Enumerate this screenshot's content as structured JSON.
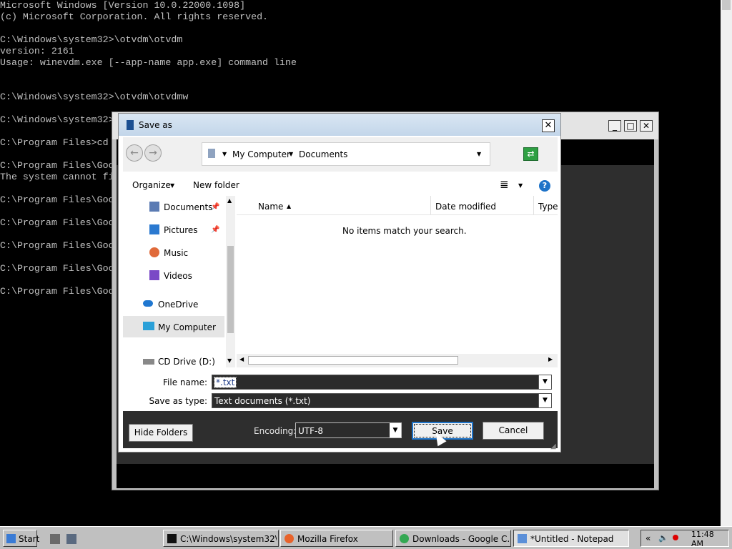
{
  "console": {
    "lines": [
      "Microsoft Windows [Version 10.0.22000.1098]",
      "(c) Microsoft Corporation. All rights reserved.",
      "",
      "C:\\Windows\\system32>\\otvdm\\otvdm",
      "version: 2161",
      "Usage: winevdm.exe [--app-name app.exe] command line",
      "",
      "",
      "C:\\Windows\\system32>\\otvdm\\otvdmw",
      "",
      "C:\\Windows\\system32>",
      "",
      "C:\\Program Files>cd",
      "",
      "C:\\Program Files\\Goo",
      "The system cannot fi",
      "",
      "C:\\Program Files\\Goo",
      "",
      "C:\\Program Files\\Goo",
      "",
      "C:\\Program Files\\Goo",
      "",
      "C:\\Program Files\\Goo",
      "",
      "C:\\Program Files\\Goo"
    ]
  },
  "notepad_window": {
    "minimize": "_",
    "maximize": "□",
    "close": "✕"
  },
  "dialog": {
    "title": "Save as",
    "close": "✕",
    "address": {
      "segments": [
        "My Computer",
        "Documents"
      ],
      "dropdown": "▼"
    },
    "toolbar": {
      "organize": "Organize",
      "new_folder": "New folder",
      "view_icon": "≣",
      "help": "?"
    },
    "tree": [
      {
        "label": "Documents",
        "icon": "documents-icon",
        "color": "#5b7bb3",
        "pinned": true
      },
      {
        "label": "Pictures",
        "icon": "pictures-icon",
        "color": "#2b79d0",
        "pinned": true
      },
      {
        "label": "Music",
        "icon": "music-icon",
        "color": "#e06a3a",
        "pinned": false
      },
      {
        "label": "Videos",
        "icon": "videos-icon",
        "color": "#7a48c6",
        "pinned": false
      },
      {
        "label": "OneDrive",
        "icon": "onedrive-icon",
        "color": "#1f77d0",
        "pinned": false
      },
      {
        "label": "My Computer",
        "icon": "computer-icon",
        "color": "#2aa0d8",
        "pinned": false
      },
      {
        "label": "CD Drive (D:)",
        "icon": "cd-drive-icon",
        "color": "#888888",
        "pinned": false
      }
    ],
    "list": {
      "columns": [
        "Name",
        "Date modified",
        "Type"
      ],
      "empty_message": "No items match your search."
    },
    "file_name_label": "File name:",
    "file_name_value": "*.txt",
    "save_type_label": "Save as type:",
    "save_type_value": "Text documents (*.txt)",
    "hide_folders": "Hide Folders",
    "encoding_label": "Encoding:",
    "encoding_value": "UTF-8",
    "save": "Save",
    "cancel": "Cancel"
  },
  "taskbar": {
    "start": "Start",
    "tasks": [
      {
        "label": "C:\\Windows\\system32\\...",
        "icon": "cmd-icon"
      },
      {
        "label": "Mozilla Firefox",
        "icon": "firefox-icon"
      },
      {
        "label": "Downloads - Google C...",
        "icon": "chrome-icon"
      },
      {
        "label": "*Untitled - Notepad",
        "icon": "notepad-icon"
      }
    ],
    "clock": "11:48 AM"
  },
  "colors": {
    "console_text": "#c0c0c0",
    "accent_blue": "#1e73c8"
  }
}
